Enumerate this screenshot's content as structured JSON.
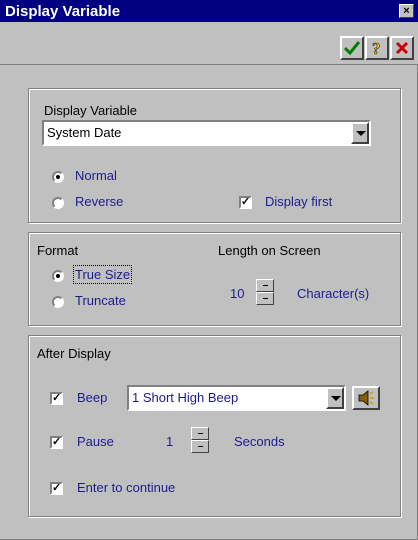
{
  "window": {
    "title": "Display Variable",
    "close_icon": "×"
  },
  "toolbar": {
    "ok_icon": "check-icon",
    "help_icon": "question-icon",
    "cancel_icon": "cancel-icon"
  },
  "variable_group": {
    "label": "Display Variable",
    "selected": "System Date",
    "radio_normal": "Normal",
    "radio_reverse": "Reverse",
    "selected_mode": "Normal",
    "display_first_label": "Display first",
    "display_first_checked": true
  },
  "format_group": {
    "label": "Format",
    "radio_true_size": "True Size",
    "radio_truncate": "Truncate",
    "selected_format": "True Size",
    "length_label": "Length on Screen",
    "length_value": "10",
    "length_unit": "Character(s)"
  },
  "after_group": {
    "label": "After Display",
    "beep_label": "Beep",
    "beep_checked": true,
    "beep_selected": "1 Short High Beep",
    "pause_label": "Pause",
    "pause_checked": true,
    "pause_value": "1",
    "pause_unit": "Seconds",
    "enter_label": "Enter to continue",
    "enter_checked": true
  },
  "colors": {
    "title_bg": "#000080",
    "face": "#c0c0c0",
    "label_blue": "#1c1c8c"
  }
}
